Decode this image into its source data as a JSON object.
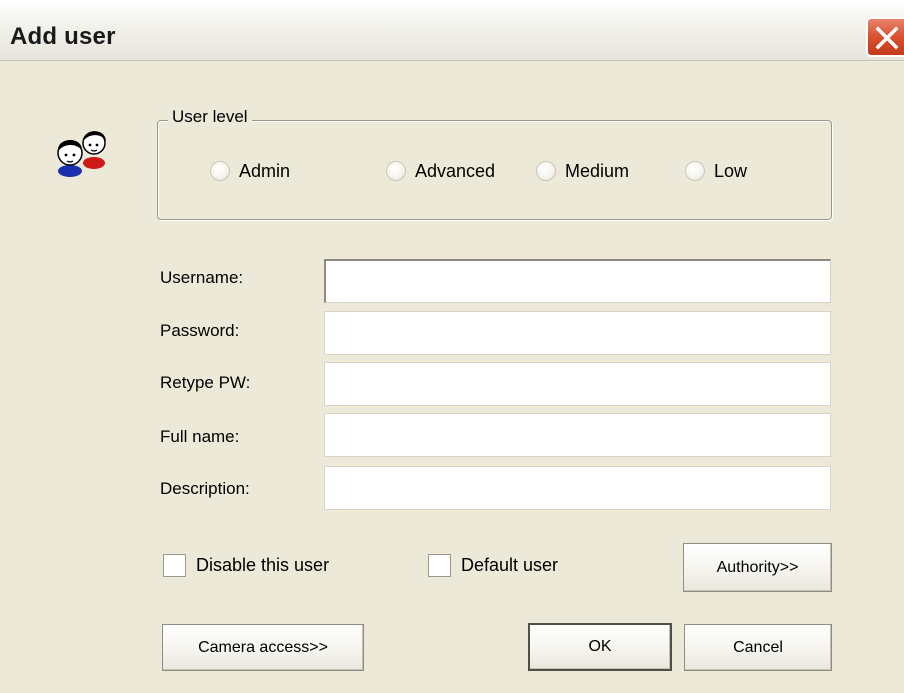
{
  "window": {
    "title": "Add user"
  },
  "icons": {
    "close": "close-icon",
    "users": "users-icon"
  },
  "user_level": {
    "legend": "User level",
    "options": [
      {
        "label": "Admin",
        "selected": false
      },
      {
        "label": "Advanced",
        "selected": false
      },
      {
        "label": "Medium",
        "selected": false
      },
      {
        "label": "Low",
        "selected": false
      }
    ]
  },
  "fields": {
    "username": {
      "label": "Username:",
      "value": ""
    },
    "password": {
      "label": "Password:",
      "value": ""
    },
    "retype": {
      "label": "Retype PW:",
      "value": ""
    },
    "fullname": {
      "label": "Full name:",
      "value": ""
    },
    "description": {
      "label": "Description:",
      "value": ""
    }
  },
  "checkboxes": {
    "disable_user": {
      "label": "Disable this user",
      "checked": false
    },
    "default_user": {
      "label": "Default user",
      "checked": false
    }
  },
  "buttons": {
    "authority": "Authority>>",
    "camera_access": "Camera access>>",
    "ok": "OK",
    "cancel": "Cancel"
  },
  "colors": {
    "dialog_bg": "#ece9d8",
    "close_red": "#d9502f"
  }
}
